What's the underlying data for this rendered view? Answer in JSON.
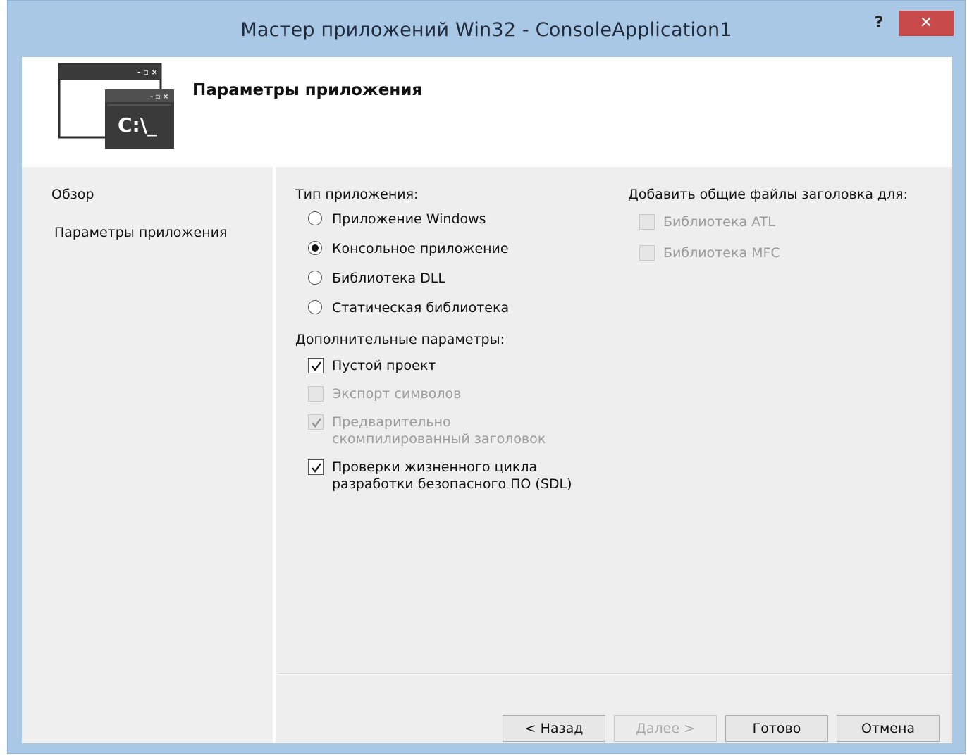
{
  "window": {
    "title": "Мастер приложений Win32 - ConsoleApplication1",
    "help_label": "?",
    "close_label": "✕"
  },
  "header": {
    "icon_prompt": "C:\\_",
    "title": "Параметры приложения"
  },
  "nav": {
    "items": [
      {
        "label": "Обзор"
      },
      {
        "label": "Параметры приложения"
      }
    ]
  },
  "app_type": {
    "title": "Тип приложения:",
    "options": [
      {
        "label": "Приложение Windows",
        "selected": false
      },
      {
        "label": "Консольное приложение",
        "selected": true
      },
      {
        "label": "Библиотека DLL",
        "selected": false
      },
      {
        "label": "Статическая библиотека",
        "selected": false
      }
    ]
  },
  "extra": {
    "title": "Дополнительные параметры:",
    "options": [
      {
        "label": "Пустой проект",
        "checked": true,
        "enabled": true
      },
      {
        "label": "Экспорт символов",
        "checked": false,
        "enabled": false
      },
      {
        "label": "Предварительно",
        "label2": "скомпилированный заголовок",
        "checked": true,
        "enabled": false
      },
      {
        "label": "Проверки жизненного цикла",
        "label2": "разработки безопасного ПО (SDL)",
        "checked": true,
        "enabled": true
      }
    ]
  },
  "headers": {
    "title": "Добавить общие файлы заголовка для:",
    "options": [
      {
        "label": "Библиотека ATL",
        "checked": false,
        "enabled": false
      },
      {
        "label": "Библиотека MFC",
        "checked": false,
        "enabled": false
      }
    ]
  },
  "buttons": {
    "back": "< Назад",
    "next": "Далее >",
    "finish": "Готово",
    "cancel": "Отмена"
  }
}
